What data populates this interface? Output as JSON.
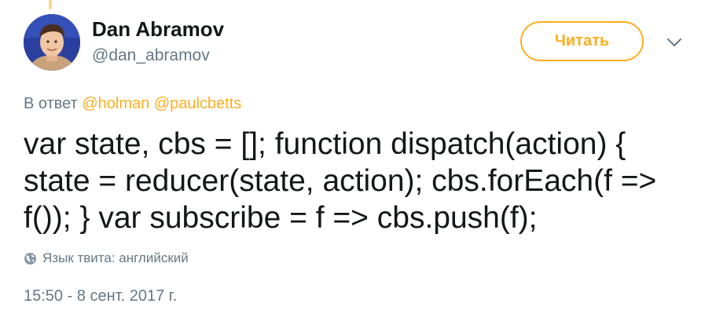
{
  "author": {
    "display_name": "Dan Abramov",
    "handle": "@dan_abramov"
  },
  "follow_button": {
    "label": "Читать"
  },
  "reply_context": {
    "prefix": "В ответ",
    "mentions": [
      "@holman",
      "@paulcbetts"
    ]
  },
  "tweet": {
    "text": "var state, cbs = []; function dispatch(action) { state = reducer(state, action); cbs.forEach(f => f()); } var subscribe = f => cbs.push(f);",
    "language_label": "Язык твита: английский",
    "timestamp": "15:50 - 8 сент. 2017 г."
  },
  "icons": {
    "more": "chevron-down-icon",
    "language": "globe-icon"
  },
  "colors": {
    "accent": "#ffad1f",
    "text_primary": "#14171a",
    "text_secondary": "#657786"
  }
}
